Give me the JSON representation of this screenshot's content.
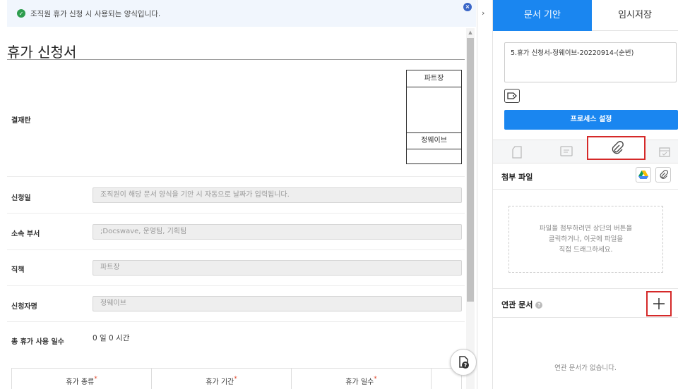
{
  "notice": {
    "text": "조직원 휴가 신청 시 사용되는 양식입니다.",
    "check_icon": "check-circle-icon",
    "close_icon": "close-icon"
  },
  "form": {
    "title": "휴가 신청서",
    "approval": {
      "label": "결재란",
      "role": "파트장",
      "approver": "정웨이브"
    },
    "fields": [
      {
        "label": "신청일",
        "value": "조직원이 해당 문서 양식을 기안 시 자동으로 날짜가 입력됩니다."
      },
      {
        "label": "소속 부서",
        "value": ";Docswave, 운영팀, 기획팀"
      },
      {
        "label": "직책",
        "value": "파트장"
      },
      {
        "label": "신청자명",
        "value": "정웨이브"
      }
    ],
    "total_days": {
      "label": "총 휴가 사용 일수",
      "value": "0 일 0 시간"
    },
    "leave_table": {
      "headers": [
        "휴가 종류",
        "휴가 기간",
        "휴가 일수"
      ],
      "required_mark": "*"
    }
  },
  "right_panel": {
    "tabs": [
      {
        "label": "문서 기안",
        "active": true
      },
      {
        "label": "임시저장",
        "active": false
      }
    ],
    "doc_name": "5.휴가 신청서-정웨이브-20220914-(순번)",
    "process_button": "프로세스 설정",
    "icon_tabs": [
      "document-icon",
      "comment-icon",
      "paperclip-icon",
      "calendar-icon"
    ],
    "attachments": {
      "title": "첨부 파일",
      "dropzone_text": "파일을 첨부하려면 상단의 버튼을\n클릭하거나, 이곳에 파일을\n직접 드래그하세요."
    },
    "related": {
      "title": "연관 문서",
      "empty_text": "연관 문서가 없습니다."
    }
  },
  "colors": {
    "primary": "#1a86f0",
    "highlight": "#d52929",
    "notice_bg": "#f1f6fd"
  }
}
